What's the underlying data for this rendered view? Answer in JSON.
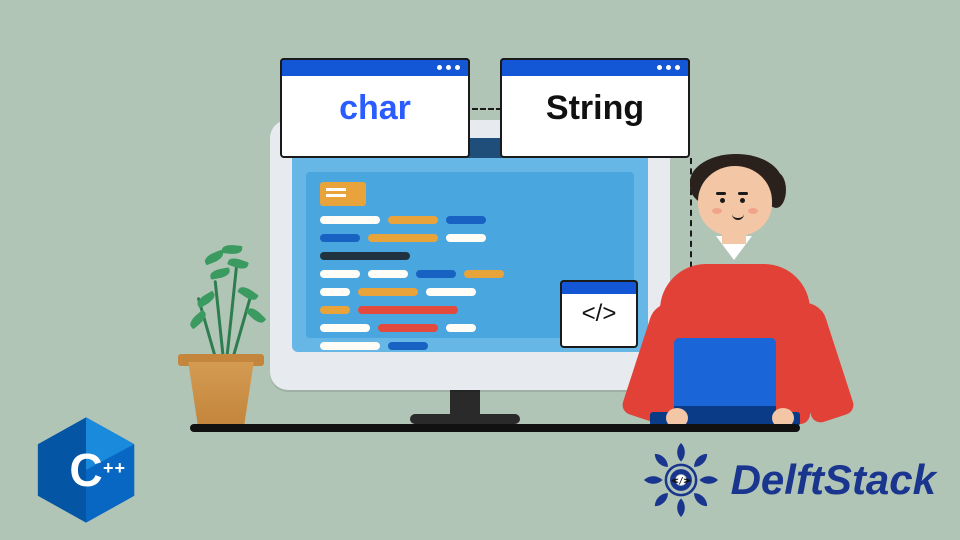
{
  "labels": {
    "char": "char",
    "string": "String",
    "code_tag": "</>"
  },
  "badges": {
    "cpp_letter": "C",
    "cpp_plus": "++"
  },
  "brand": {
    "name": "DelftStack"
  },
  "colors": {
    "background": "#b1c5b7",
    "accent_blue": "#1457d6",
    "char_text": "#2a5cff",
    "brand_text": "#19358e",
    "shirt": "#e24138"
  }
}
